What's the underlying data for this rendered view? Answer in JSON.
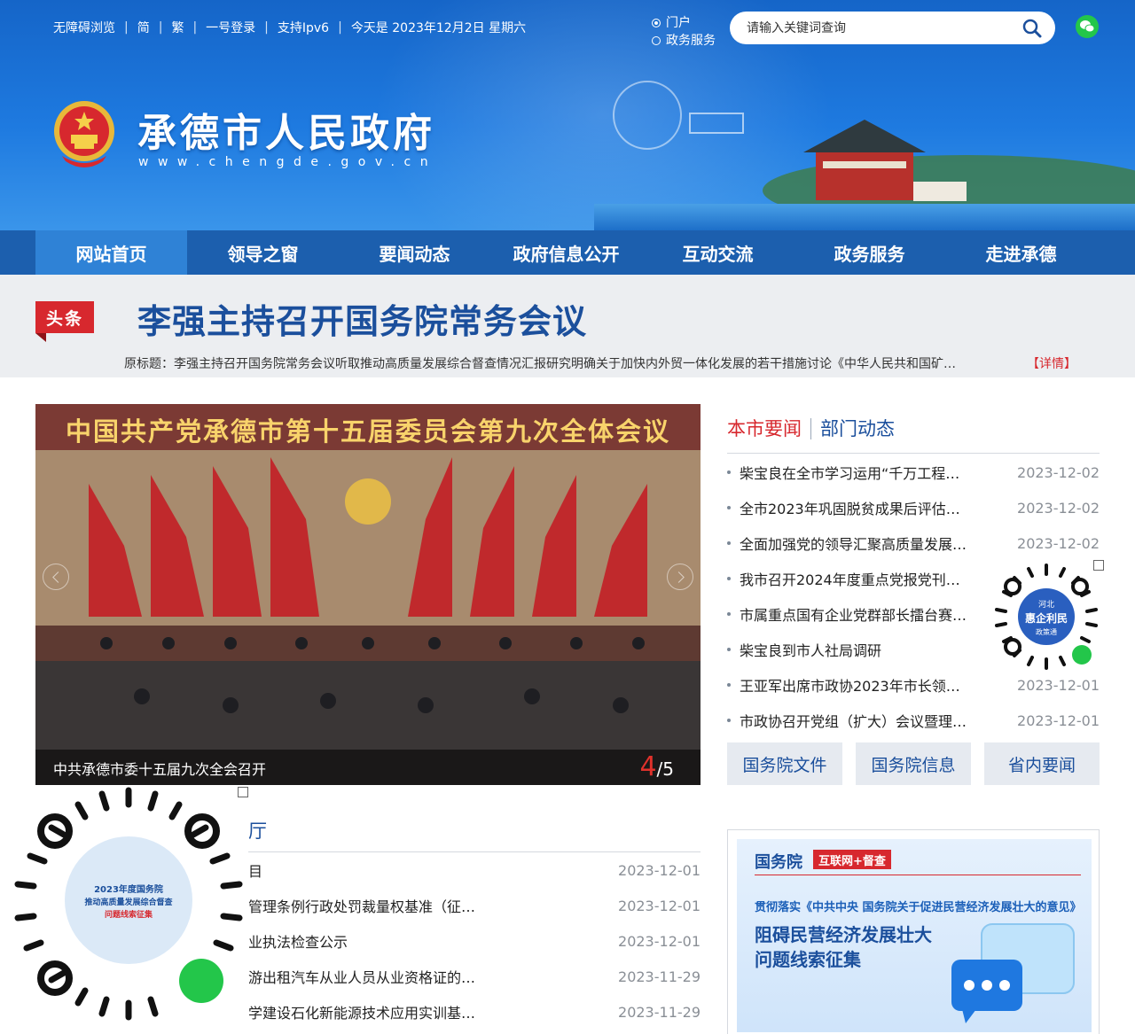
{
  "colors": {
    "brand_blue": "#1c5fae",
    "nav_active": "#2f82d6",
    "accent_red": "#d7282e",
    "title_blue": "#1b4f9c"
  },
  "toplinks": [
    "无障碍浏览",
    "简",
    "繁",
    "一号登录",
    "支持Ipv6",
    "今天是 2023年12月2日 星期六"
  ],
  "search": {
    "options": [
      "门户",
      "政务服务"
    ],
    "placeholder": "请输入关键词查询"
  },
  "site": {
    "title": "承德市人民政府",
    "url": "www.chengde.gov.cn"
  },
  "nav": [
    "网站首页",
    "领导之窗",
    "要闻动态",
    "政府信息公开",
    "互动交流",
    "政务服务",
    "走进承德"
  ],
  "headline": {
    "badge": "头条",
    "title": "李强主持召开国务院常务会议",
    "sub": "原标题：李强主持召开国务院常务会议听取推动高质量发展综合督查情况汇报研究明确关于加快内外贸一体化发展的若干措施讨论《中华人民共和国矿…",
    "more": "【详情】"
  },
  "slide": {
    "banner": "中国共产党承德市第十五届委员会第九次全体会议",
    "caption": "中共承德市委十五届九次全会召开",
    "current": "4",
    "total": "/5"
  },
  "news": {
    "tabs": [
      "本市要闻",
      "部门动态"
    ],
    "items": [
      {
        "title": "柴宝良在全市学习运用“千万工程…",
        "date": "2023-12-02"
      },
      {
        "title": "全市2023年巩固脱贫成果后评估…",
        "date": "2023-12-02"
      },
      {
        "title": "全面加强党的领导汇聚高质量发展…",
        "date": "2023-12-02"
      },
      {
        "title": "我市召开2024年度重点党报党刊…",
        "date": ""
      },
      {
        "title": "市属重点国有企业党群部长擂台赛…",
        "date": ""
      },
      {
        "title": "柴宝良到市人社局调研",
        "date": ""
      },
      {
        "title": "王亚军出席市政协2023年市长领…",
        "date": "2023-12-01"
      },
      {
        "title": "市政协召开党组（扩大）会议暨理…",
        "date": "2023-12-01"
      }
    ]
  },
  "buttons": [
    "国务院文件",
    "国务院信息",
    "省内要闻"
  ],
  "qr_small": {
    "lines": [
      "河北",
      "惠企利民",
      "政策通"
    ]
  },
  "qr_big": {
    "lines": [
      "2023年度国务院",
      "推动高质量发展综合督查",
      "问题线索征集"
    ]
  },
  "section": {
    "title": "厅",
    "items": [
      {
        "title": "目",
        "date": "2023-12-01"
      },
      {
        "title": "管理条例行政处罚裁量权基准（征…",
        "date": "2023-12-01"
      },
      {
        "title": "业执法检查公示",
        "date": "2023-12-01"
      },
      {
        "title": "游出租汽车从业人员从业资格证的…",
        "date": "2023-11-29"
      },
      {
        "title": "学建设石化新能源技术应用实训基…",
        "date": "2023-11-29"
      }
    ]
  },
  "promo": {
    "brand": "国务院",
    "tag": "互联网+督查",
    "line1": "贯彻落实《中共中央 国务院关于促进民营经济发展壮大的意见》",
    "line2": "阻碍民营经济发展壮大",
    "line3": "问题线索征集"
  }
}
